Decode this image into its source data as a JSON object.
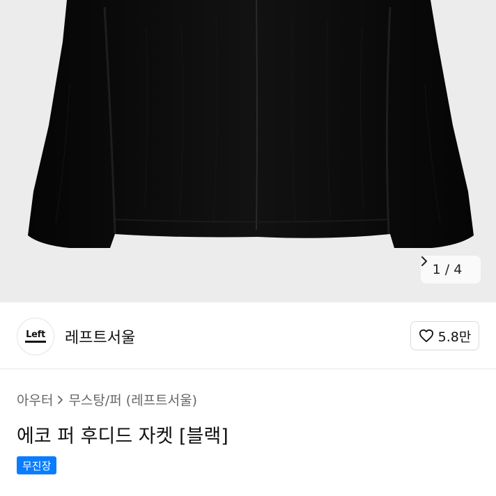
{
  "product_images": {
    "current": 1,
    "total": 4,
    "counter_separator": "/",
    "image_icon": "fur-jacket-photo",
    "next_icon": "chevron-right-icon"
  },
  "shop": {
    "logo_text": "Left",
    "name": "레프트서울",
    "likes_label": "5.8만",
    "like_icon": "heart-outline-icon"
  },
  "breadcrumb": {
    "category": "아우터",
    "separator_icon": "chevron-right-icon",
    "subcategory": "무스탕/퍼",
    "brand": "(레프트서울)"
  },
  "product": {
    "title": "에코 퍼 후디드 자켓 [블랙]",
    "badge": "무진장"
  },
  "colors": {
    "image_background": "#ececec",
    "badge_background": "#0a7cff",
    "text_primary": "#111111",
    "text_secondary": "#666666"
  }
}
